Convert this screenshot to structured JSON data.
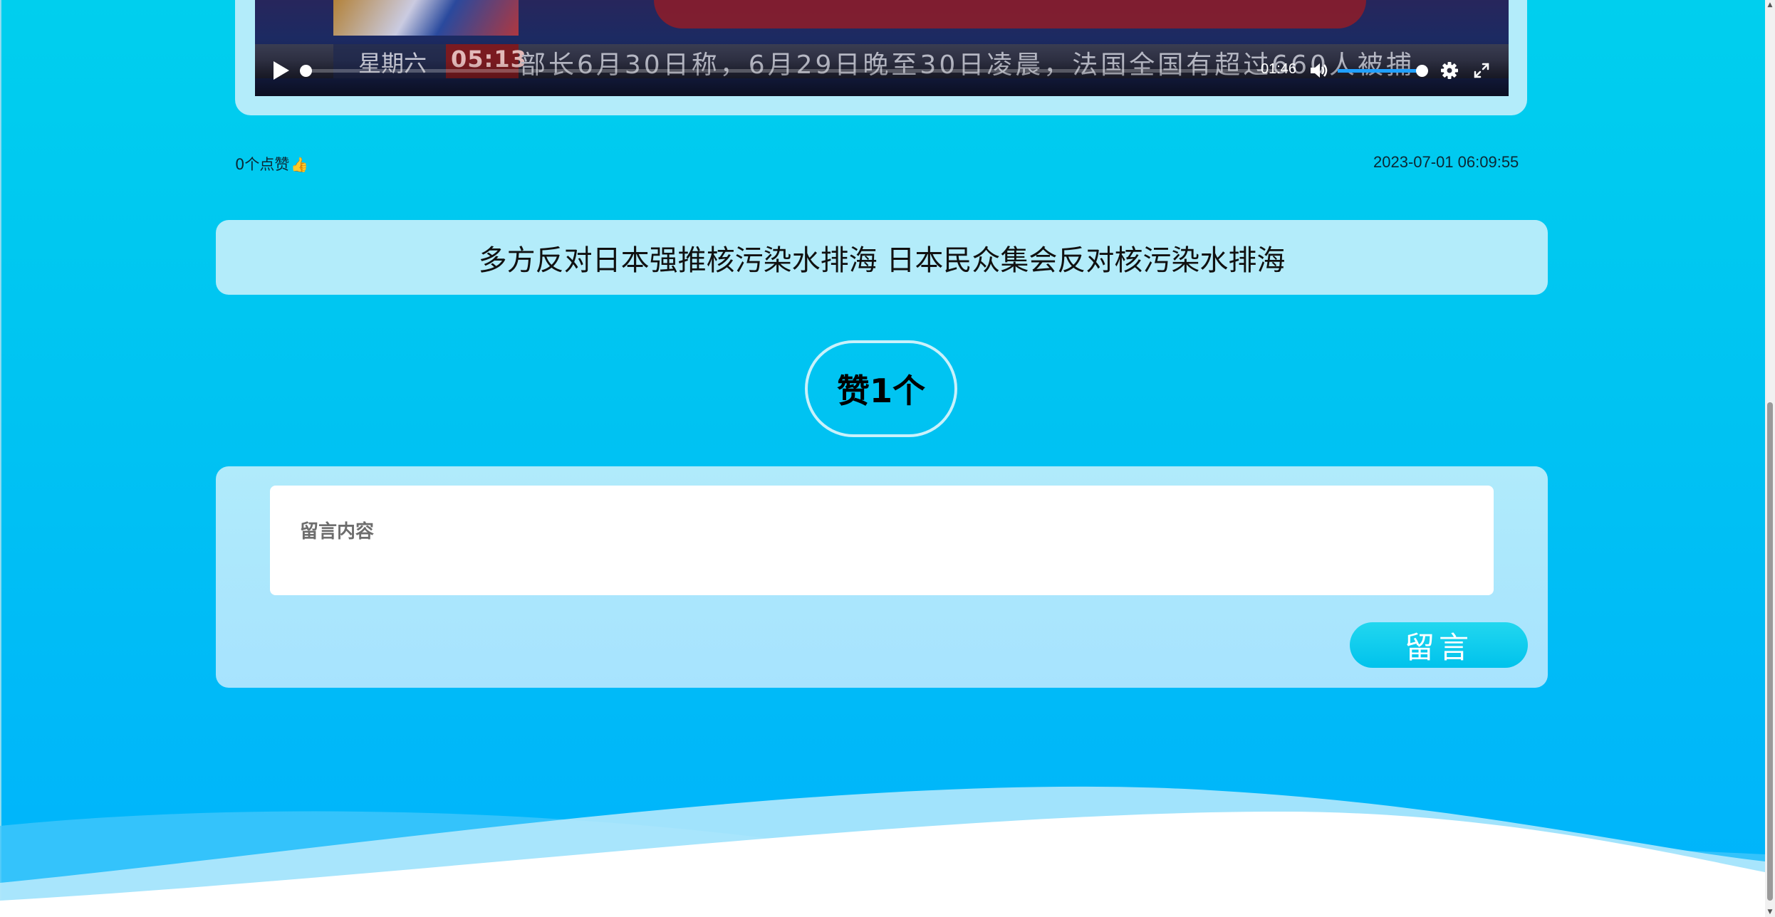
{
  "video": {
    "ticker_day": "星期六",
    "ticker_time": "05:13",
    "ticker_text": "部长6月30日称，6月29日晚至30日凌晨，法国全国有超过660人被捕",
    "time_readout": "01:46",
    "progress_fraction": 0.0,
    "volume_fraction": 1.0
  },
  "meta": {
    "likes_label": "0个点赞",
    "likes_icon": "thumbs-up-icon",
    "timestamp": "2023-07-01 06:09:55"
  },
  "article": {
    "title": "多方反对日本强推核污染水排海 日本民众集会反对核污染水排海"
  },
  "like_button": {
    "label": "赞1个"
  },
  "comment": {
    "placeholder": "留言内容",
    "submit_label": "留言"
  },
  "colors": {
    "background_top": "#00cfee",
    "background_bottom": "#00b3fc",
    "card": "#b3ecfa",
    "accent": "#00c2ec"
  }
}
